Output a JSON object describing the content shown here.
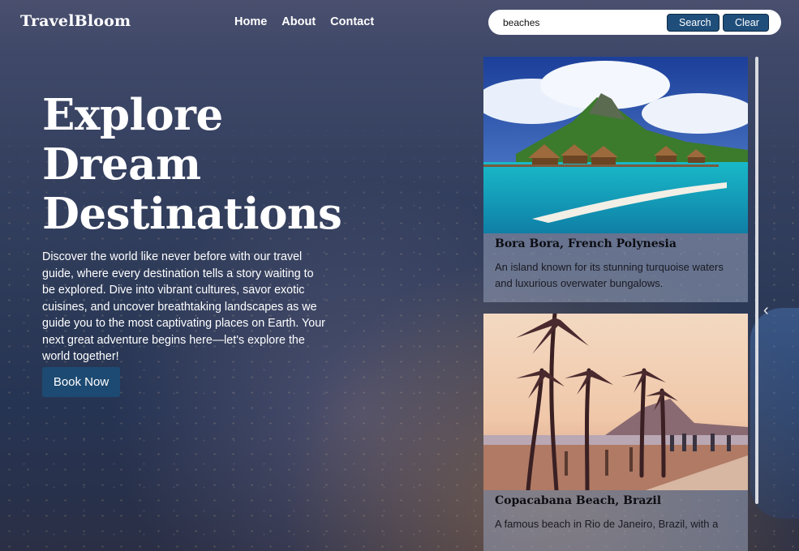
{
  "brand": "TravelBloom",
  "nav": [
    "Home",
    "About",
    "Contact"
  ],
  "search": {
    "value": "beaches",
    "search_label": "Search",
    "clear_label": "Clear"
  },
  "hero": {
    "title_lines": [
      "Explore",
      "Dream",
      "Destinations"
    ],
    "description": "Discover the world like never before with our travel guide, where every destination tells a story waiting to be explored. Dive into vibrant cultures, savor exotic cuisines, and uncover breathtaking landscapes as we guide you to the most captivating places on Earth. Your next great adventure begins here—let's explore the world together!",
    "cta": "Book Now"
  },
  "cards": [
    {
      "title": "Bora Bora, French Polynesia",
      "description": "An island known for its stunning turquoise waters and luxurious overwater bungalows.",
      "image_icon": "tropical-island-image"
    },
    {
      "title": "Copacabana Beach, Brazil",
      "description": "A famous beach in Rio de Janeiro, Brazil, with a",
      "image_icon": "palm-beach-image"
    }
  ],
  "carousel_arrow": "‹"
}
